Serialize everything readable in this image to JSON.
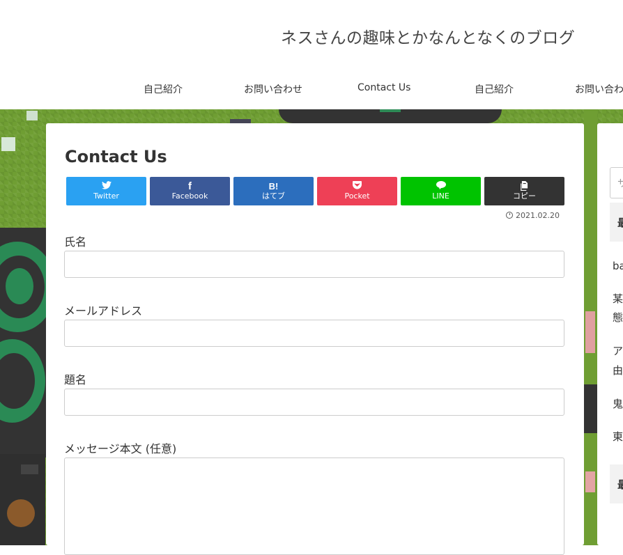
{
  "site": {
    "title": "ネスさんの趣味とかなんとなくのブログ"
  },
  "nav": {
    "items": [
      "自己紹介",
      "お問い合わせ",
      "Contact Us",
      "自己紹介",
      "お問い合わ"
    ]
  },
  "page": {
    "title": "Contact Us",
    "date": "2021.02.20"
  },
  "share": {
    "buttons": [
      {
        "label": "Twitter",
        "icon": "twitter-bird-icon",
        "glyph": "🐦",
        "color": "#2aa1f2"
      },
      {
        "label": "Facebook",
        "icon": "facebook-f-icon",
        "glyph": "f",
        "color": "#3b5998"
      },
      {
        "label": "はてブ",
        "icon": "hatena-b-icon",
        "glyph": "B!",
        "color": "#2c6ebd"
      },
      {
        "label": "Pocket",
        "icon": "pocket-icon",
        "glyph": "⬇",
        "color": "#ee4056"
      },
      {
        "label": "LINE",
        "icon": "line-icon",
        "glyph": "●",
        "color": "#00c300"
      },
      {
        "label": "コピー",
        "icon": "copy-icon",
        "glyph": "❐",
        "color": "#333333"
      }
    ]
  },
  "form": {
    "name_label": "氏名",
    "email_label": "メールアドレス",
    "subject_label": "題名",
    "message_label": "メッセージ本文 (任意)",
    "name_value": "",
    "email_value": "",
    "subject_value": "",
    "message_value": ""
  },
  "sidebar": {
    "search_placeholder": "サ",
    "widget1_head": "最",
    "widget2_head": "最",
    "items": [
      "ba",
      "某",
      "態",
      "ア",
      "由",
      "鬼",
      "東"
    ]
  }
}
